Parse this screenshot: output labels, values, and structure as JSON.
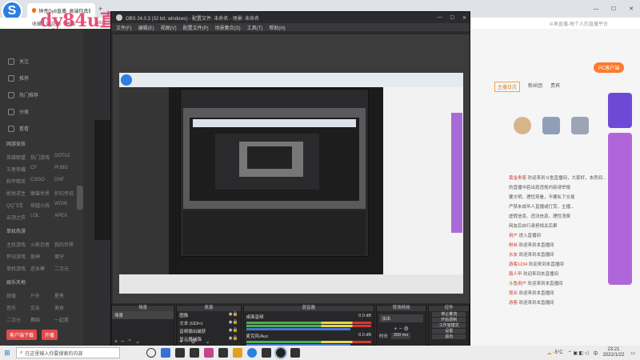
{
  "browser": {
    "tab1_title": "钟亮Dy8直播_高端你真的...",
    "tab2_title": "",
    "address": "https://www.douyu.com/...",
    "bookmarks": [
      "收藏",
      "同花顺",
      "高端"
    ],
    "watermark": "dy84u直播",
    "right_address_hint": "斗鱼直播-每个人的直播平台"
  },
  "sidebar": {
    "items": [
      "关注",
      "推荐",
      "热门推荐",
      "分类",
      "看看"
    ],
    "section_hot": "网游竞技",
    "hot_grid": [
      "英雄联盟",
      "热门游戏",
      "DOTA2",
      "王者荣耀",
      "CF",
      "PUBG",
      "和平精英",
      "CSGO",
      "DNF",
      "绝地求生",
      "魔兽世界",
      "炉石传说",
      "QQ飞车",
      "穿越火线",
      "WOW",
      "云顶之弈",
      "LOL",
      "APEX"
    ],
    "section_fun": "单机热游",
    "fun_grid": [
      "主机游戏",
      "火影忍者",
      "我的世界",
      "怀旧游戏",
      "原神",
      "蛋仔",
      "单机游戏",
      "逆水寒",
      "二次元"
    ],
    "section_ent": "娱乐天地",
    "ent_grid": [
      "颜值",
      "户外",
      "星秀",
      "音乐",
      "交友",
      "美食",
      "二次元",
      "舞蹈",
      "一起看"
    ],
    "btn_download": "客户端下载",
    "btn_live": "开播"
  },
  "obs": {
    "title": "OBS 24.0.3 (32 bit, windows) - 配置文件: 未命名 - 场景: 未命名",
    "menu": [
      "文件(F)",
      "编辑(E)",
      "视图(V)",
      "配置文件(P)",
      "场景集合(S)",
      "工具(T)",
      "帮助(H)"
    ],
    "docks": {
      "scenes": "场景",
      "sources": "来源",
      "mixer": "混音器",
      "transitions": "转场特效",
      "controls": "控件"
    },
    "scene_items": [
      "场景"
    ],
    "source_items": [
      "图像",
      "文本 (GDI+)",
      "音频输出捕获",
      "显示器捕获"
    ],
    "mixer": [
      {
        "name": "桌面音频",
        "db": "0.0 dB"
      },
      {
        "name": "麦克风/Aux",
        "db": "0.0 dB"
      }
    ],
    "transition_value": "淡出",
    "duration_label": "时长",
    "duration_value": "300 ms",
    "control_buttons": [
      "停止推流",
      "开始录制",
      "工作室模式",
      "设置",
      "退出"
    ]
  },
  "rightpanel": {
    "chat": [
      {
        "name": "黄金贵客",
        "text": "欢迎来到斗鱼直播间，大家好，本房间..."
      },
      {
        "name": "",
        "text": "的直播中若出现违规内容请举报"
      },
      {
        "name": "",
        "text": "要文明，理性观看，不要私下交易"
      },
      {
        "name": "",
        "text": "严禁未成年人直播或打赏，主播..."
      },
      {
        "name": "",
        "text": "虚假信息、违法信息，理性消费"
      },
      {
        "name": "",
        "text": "网友后自行承担相关后果"
      },
      {
        "name": "用户",
        "text": "进入直播间"
      },
      {
        "name": "粉丝",
        "text": "欢迎来到本直播间"
      },
      {
        "name": "水友",
        "text": "欢迎来到本直播间"
      },
      {
        "name": "游客1234",
        "text": "欢迎来到本直播间"
      },
      {
        "name": "路人甲",
        "text": "欢迎来到本直播间"
      },
      {
        "name": "斗鱼用户",
        "text": "欢迎来到本直播间"
      },
      {
        "name": "观众",
        "text": "欢迎来到本直播间"
      },
      {
        "name": "游客",
        "text": "欢迎来到本直播间"
      }
    ],
    "tab_labels": [
      "主播日志",
      "粉丝团",
      "贵宾"
    ],
    "pc_btn": "PC客户端"
  },
  "taskbar": {
    "search_placeholder": "在这里输入你要搜索的内容",
    "weather": "-5°C",
    "ime": "中",
    "time": "23:21",
    "date": "2022/1/22"
  }
}
